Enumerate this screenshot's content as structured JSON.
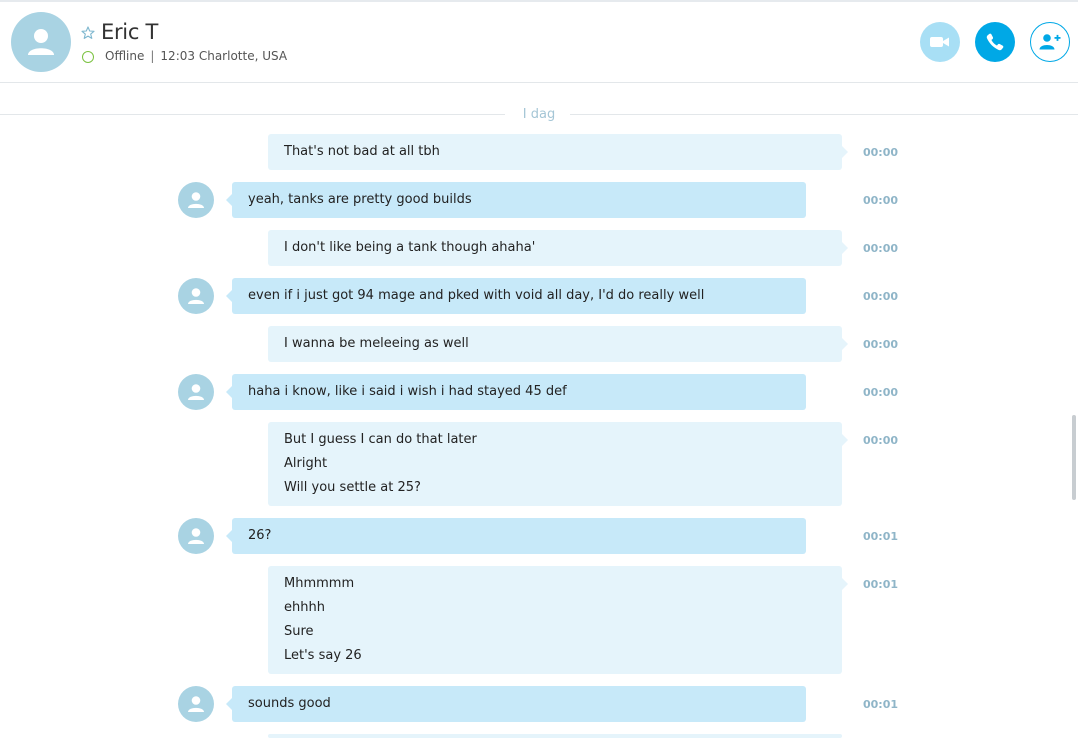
{
  "contact": {
    "name": "Eric T",
    "status": "Offline",
    "local_time": "12:03",
    "location": "Charlotte, USA",
    "separator": "|"
  },
  "header_buttons": {
    "video": "video-icon",
    "call": "phone-icon",
    "add": "add-person-icon"
  },
  "colors": {
    "accent": "#00a8e6",
    "incoming_bubble": "#c7e9f9",
    "outgoing_bubble": "#e5f4fb",
    "status_offline": "#7cc242"
  },
  "conversation": {
    "date_divider": "I dag",
    "messages": [
      {
        "direction": "out",
        "lines": [
          "That's not bad at all tbh"
        ],
        "time": "00:00"
      },
      {
        "direction": "in",
        "lines": [
          "yeah, tanks are pretty good builds"
        ],
        "time": "00:00"
      },
      {
        "direction": "out",
        "lines": [
          "I don't like being a tank though ahaha'"
        ],
        "time": "00:00"
      },
      {
        "direction": "in",
        "lines": [
          "even if i just got 94 mage and pked with void all day, I'd do really well"
        ],
        "time": "00:00"
      },
      {
        "direction": "out",
        "lines": [
          "I wanna be meleeing as well"
        ],
        "time": "00:00"
      },
      {
        "direction": "in",
        "lines": [
          "haha i know, like i said i wish i had stayed 45 def"
        ],
        "time": "00:00"
      },
      {
        "direction": "out",
        "lines": [
          "But I guess I can do that later",
          "Alright",
          "Will you settle at 25?"
        ],
        "time": "00:00"
      },
      {
        "direction": "in",
        "lines": [
          "26?"
        ],
        "time": "00:01"
      },
      {
        "direction": "out",
        "lines": [
          "Mhmmmm",
          "ehhhh",
          "Sure",
          "Let's say 26"
        ],
        "time": "00:01"
      },
      {
        "direction": "in",
        "lines": [
          "sounds good"
        ],
        "time": "00:01"
      }
    ]
  }
}
